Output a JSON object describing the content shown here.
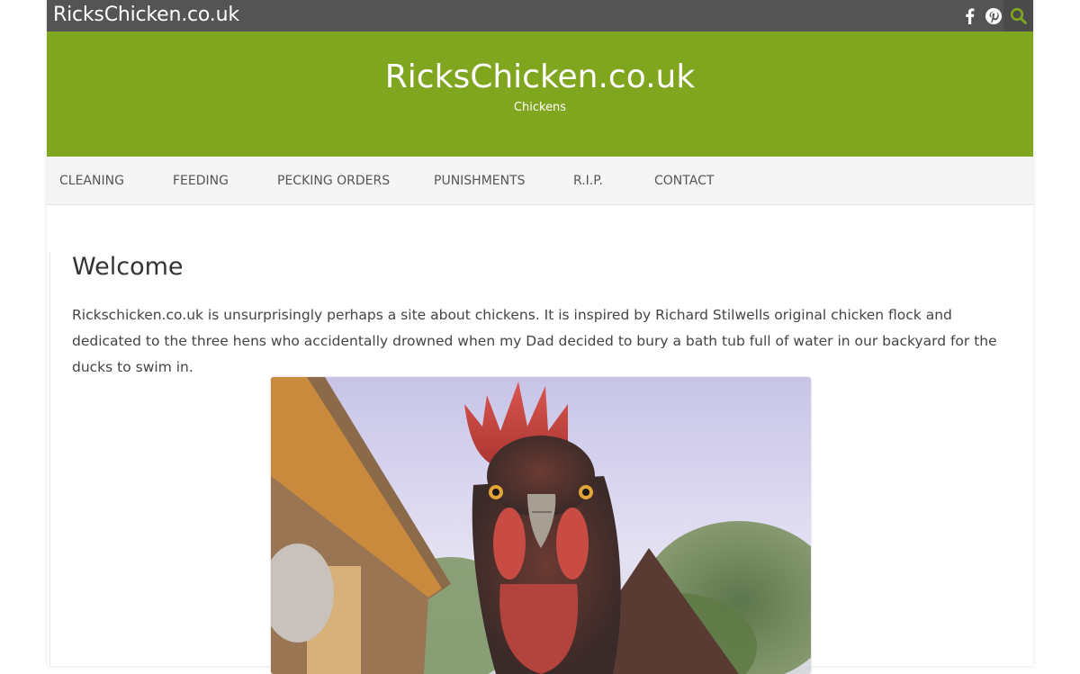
{
  "topbar": {
    "site_name": "RicksChicken.co.uk",
    "social": [
      {
        "icon": "facebook-icon"
      },
      {
        "icon": "pinterest-icon"
      }
    ],
    "search_icon": "search-icon"
  },
  "header": {
    "title": "RicksChicken.co.uk",
    "tagline": "Chickens",
    "background": "#80a51e"
  },
  "nav": {
    "items": [
      {
        "label": "CLEANING"
      },
      {
        "label": "FEEDING"
      },
      {
        "label": "PECKING ORDERS"
      },
      {
        "label": "PUNISHMENTS"
      },
      {
        "label": "R.I.P."
      },
      {
        "label": "CONTACT"
      }
    ]
  },
  "main": {
    "heading": "Welcome",
    "intro": "Rickschicken.co.uk is unsurprisingly perhaps a site about chickens. It is inspired by Richard Stilwells original chicken flock and dedicated to the three hens who accidentally drowned when my Dad decided to bury a bath tub full of water in our backyard for the ducks to swim in."
  },
  "colors": {
    "accent": "#80a51e",
    "topbar": "#545454",
    "nav_bg": "#f5f5f5"
  }
}
